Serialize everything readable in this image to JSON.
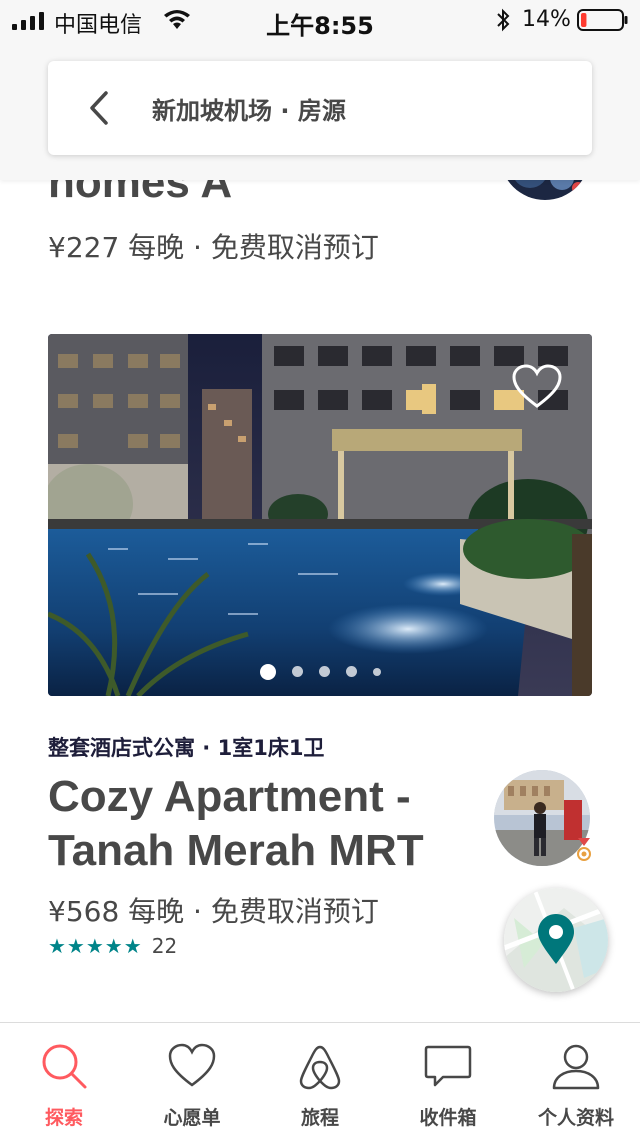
{
  "status_bar": {
    "carrier": "中国电信",
    "time": "上午8:55",
    "battery_percent": "14%",
    "battery_level": 0.14,
    "icons": [
      "signal-icon",
      "wifi-icon",
      "bluetooth-icon",
      "battery-icon"
    ]
  },
  "header": {
    "title": "新加坡机场 · 房源",
    "back_icon": "chevron-left-icon"
  },
  "previous_listing": {
    "title_fragment": "homes A",
    "price": "¥227 每晚 · 免费取消预订"
  },
  "listing": {
    "type": "整套酒店式公寓 · 1室1床1卫",
    "title": "Cozy Apartment - Tanah Merah MRT",
    "price": "¥568 每晚 · 免费取消预订",
    "stars": "★★★★★",
    "rating": 5,
    "reviews": "22",
    "photo_count": 5,
    "active_photo": 1
  },
  "map_button": {
    "icon": "map-pin-icon"
  },
  "tabs": [
    {
      "label": "探索",
      "icon": "search-icon",
      "active": true
    },
    {
      "label": "心愿单",
      "icon": "heart-icon",
      "active": false
    },
    {
      "label": "旅程",
      "icon": "airbnb-logo-icon",
      "active": false
    },
    {
      "label": "收件箱",
      "icon": "message-icon",
      "active": false
    },
    {
      "label": "个人资料",
      "icon": "profile-icon",
      "active": false
    }
  ],
  "colors": {
    "accent": "#ff5a5f",
    "teal": "#008489",
    "text": "#484848"
  }
}
